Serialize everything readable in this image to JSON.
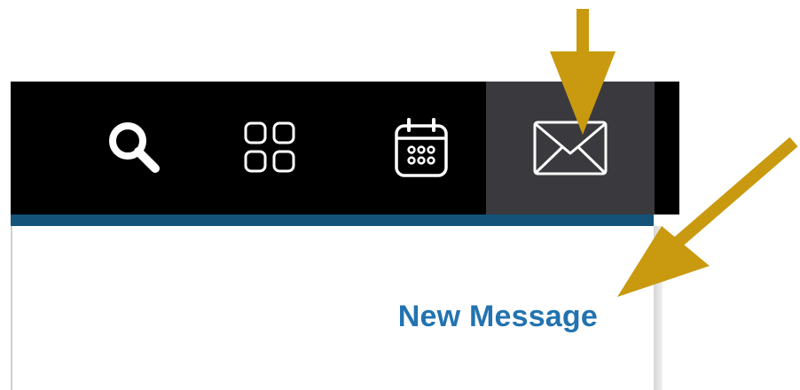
{
  "toolbar": {
    "items": [
      {
        "icon": "search-icon",
        "active": false
      },
      {
        "icon": "apps-grid-icon",
        "active": false
      },
      {
        "icon": "calendar-icon",
        "active": false
      },
      {
        "icon": "envelope-icon",
        "active": true
      }
    ]
  },
  "panel": {
    "new_message_label": "New Message"
  },
  "colors": {
    "toolbar_bg": "#000000",
    "active_tab_bg": "#3a3a3e",
    "accent_bar": "#14527a",
    "link": "#2273b0",
    "annotation_arrow": "#c99a0f"
  }
}
